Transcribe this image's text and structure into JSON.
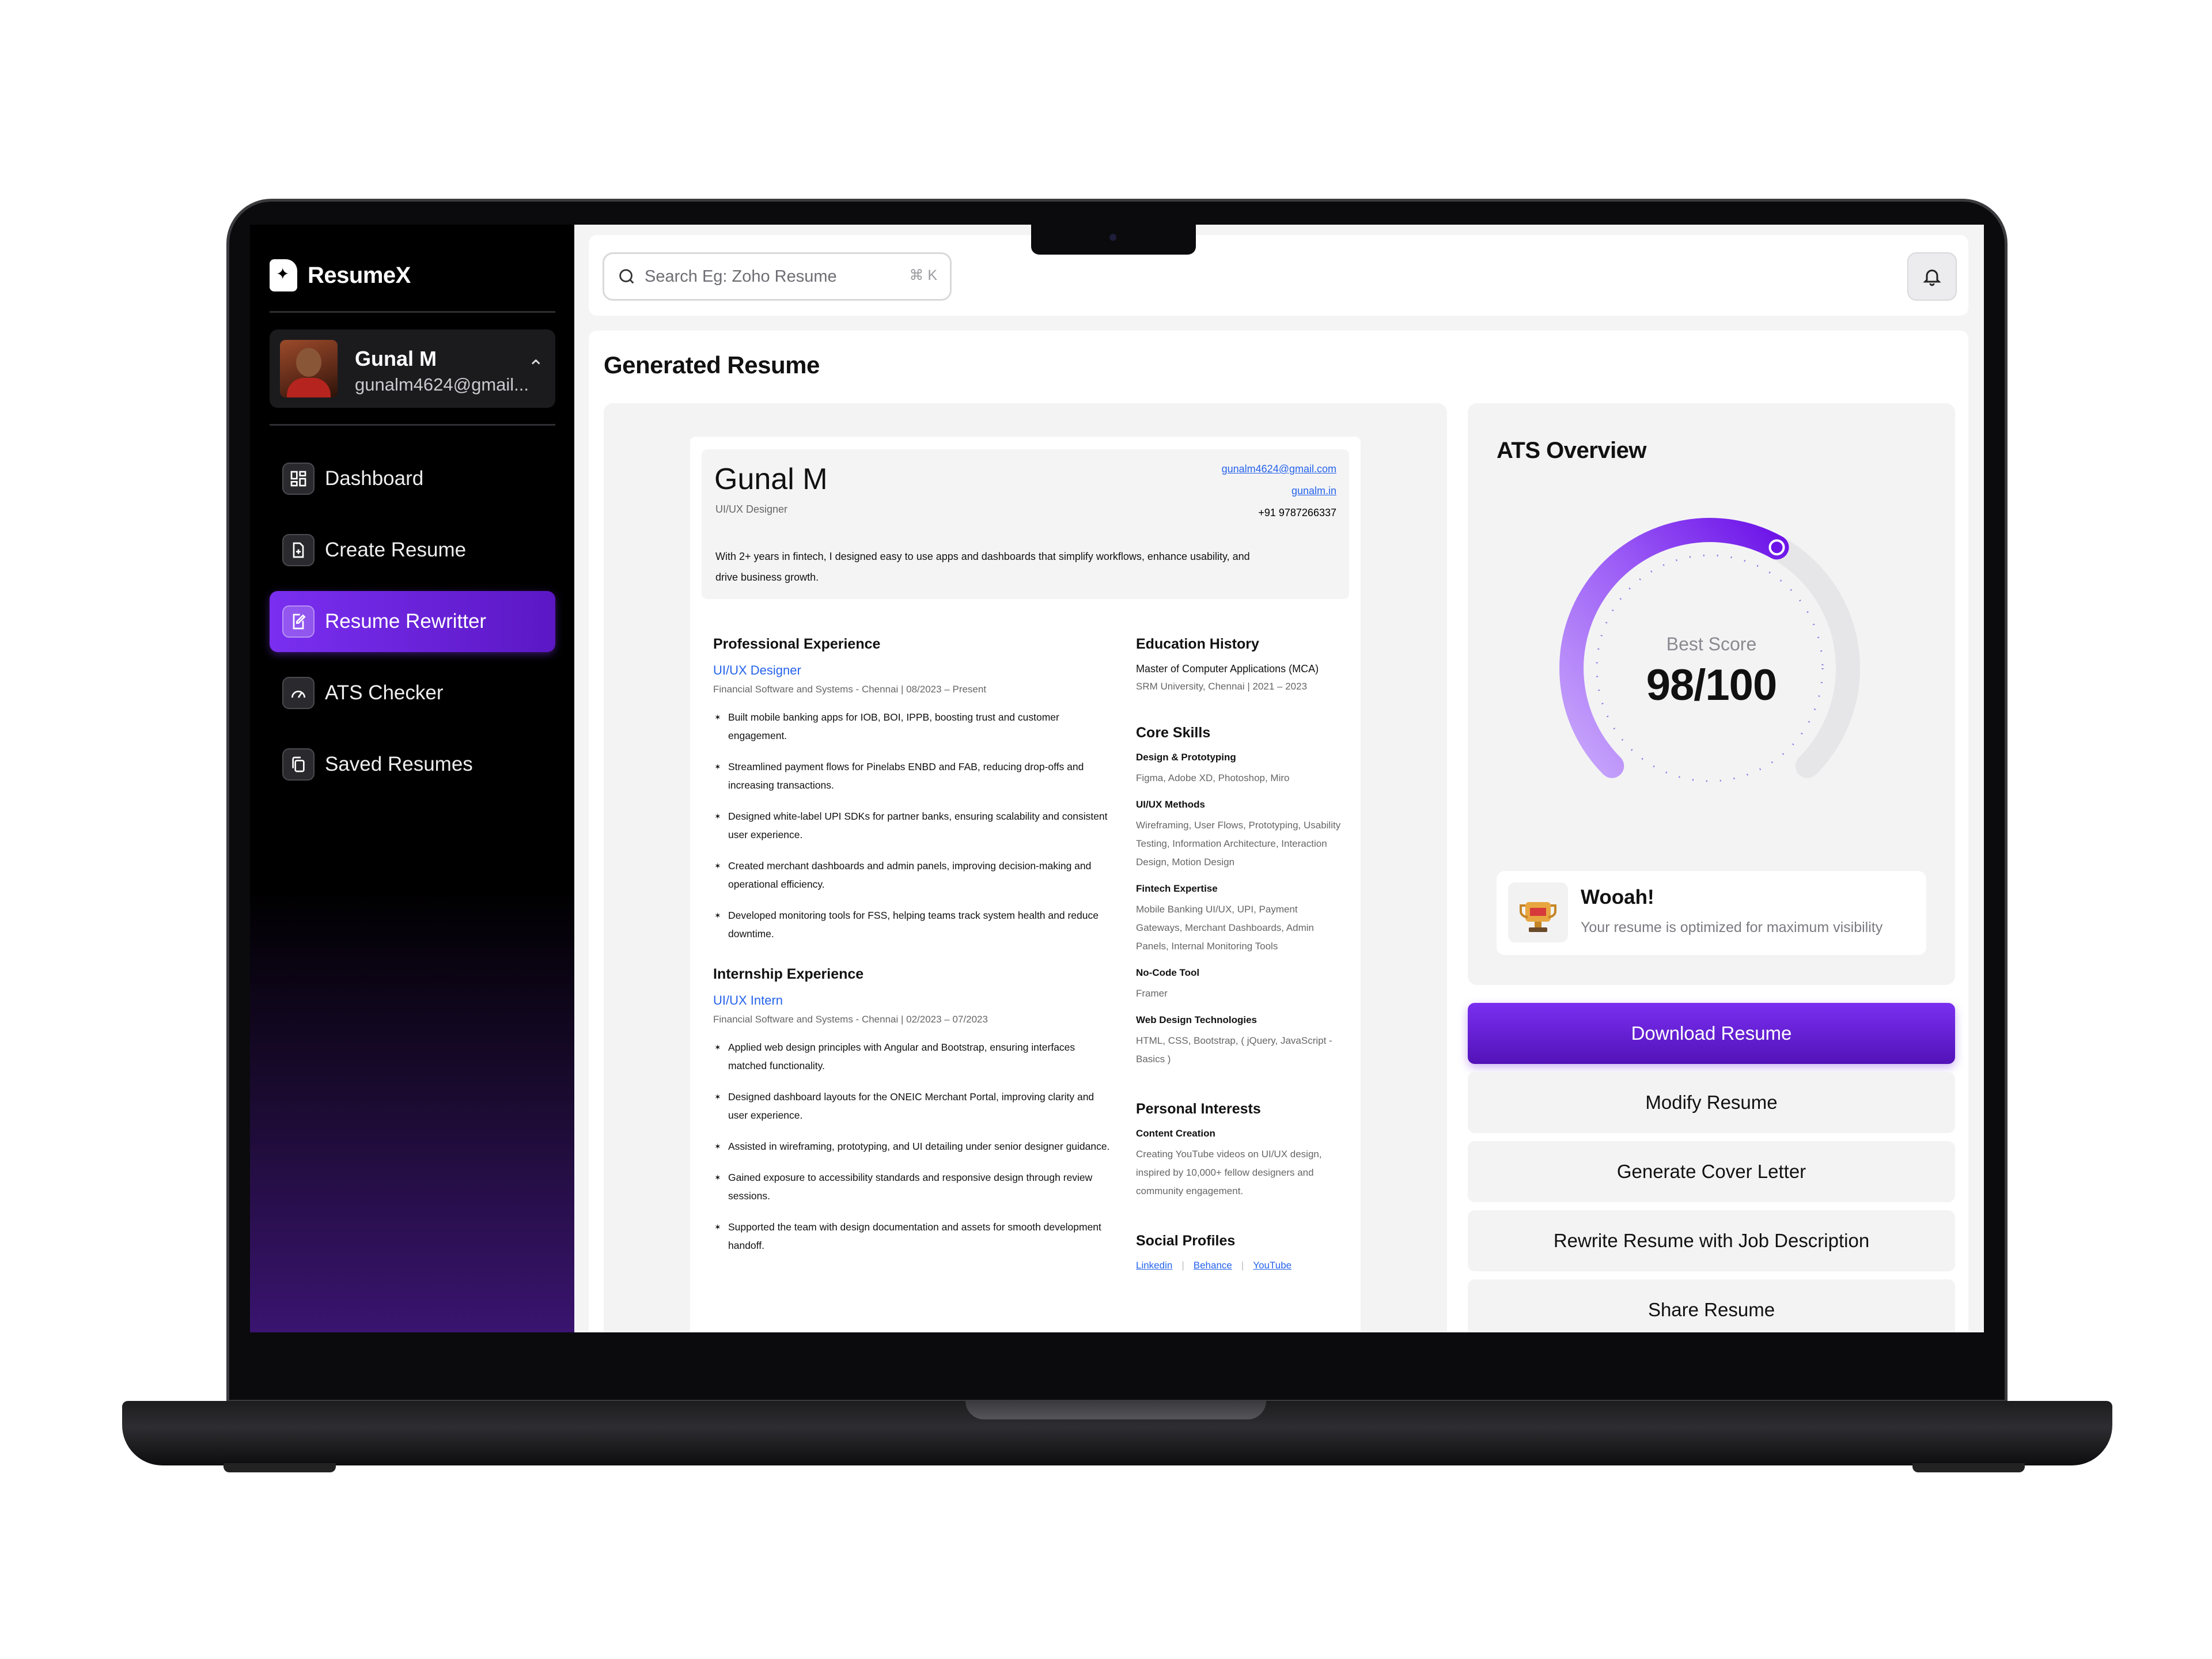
{
  "app": {
    "name": "ResumeX"
  },
  "profile": {
    "name": "Gunal M",
    "email": "gunalm4624@gmail..."
  },
  "nav": [
    {
      "label": "Dashboard",
      "active": false,
      "icon": "grid-icon"
    },
    {
      "label": "Create Resume",
      "active": false,
      "icon": "file-plus-icon"
    },
    {
      "label": "Resume Rewritter",
      "active": true,
      "icon": "edit-icon"
    },
    {
      "label": "ATS Checker",
      "active": false,
      "icon": "gauge-icon"
    },
    {
      "label": "Saved Resumes",
      "active": false,
      "icon": "copy-icon"
    }
  ],
  "search": {
    "placeholder": "Search Eg: Zoho Resume",
    "shortcut": "⌘ K"
  },
  "main": {
    "title": "Generated Resume"
  },
  "resume": {
    "name": "Gunal M",
    "title": "UI/UX Designer",
    "email": "gunalm4624@gmail.com",
    "website": "gunalm.in",
    "phone": "+91 9787266337",
    "summary": "With 2+ years in fintech, I designed easy to use apps and dashboards that simplify workflows, enhance usability, and drive business growth.",
    "experience": {
      "heading": "Professional Experience",
      "role": "UI/UX Designer",
      "meta": "Financial Software and Systems - Chennai   |   08/2023 – Present",
      "bullets": [
        "Built mobile banking apps for IOB, BOI, IPPB, boosting trust and customer engagement.",
        "Streamlined payment flows for Pinelabs ENBD and FAB, reducing drop-offs and increasing transactions.",
        "Designed white-label UPI SDKs for partner banks, ensuring scalability and consistent user experience.",
        "Created merchant dashboards and admin panels, improving decision-making and operational efficiency.",
        "Developed monitoring tools for FSS, helping teams track system health and reduce downtime."
      ]
    },
    "internship": {
      "heading": "Internship Experience",
      "role": "UI/UX Intern",
      "meta": "Financial Software and Systems - Chennai   |   02/2023 – 07/2023",
      "bullets": [
        "Applied web design principles with Angular and Bootstrap, ensuring interfaces matched functionality.",
        "Designed dashboard layouts for the ONEIC Merchant Portal, improving clarity and user experience.",
        "Assisted in wireframing, prototyping, and UI detailing under senior designer guidance.",
        "Gained exposure to accessibility standards and responsive design through review sessions.",
        "Supported the team with design documentation and assets for smooth development handoff."
      ]
    },
    "education": {
      "heading": "Education History",
      "degree": "Master of Computer Applications (MCA)",
      "meta": "SRM University, Chennai   |   2021 – 2023"
    },
    "skills": {
      "heading": "Core Skills",
      "groups": [
        {
          "title": "Design & Prototyping",
          "text": "Figma, Adobe XD, Photoshop, Miro"
        },
        {
          "title": "UI/UX Methods",
          "text": "Wireframing, User Flows, Prototyping, Usability Testing, Information Architecture, Interaction Design, Motion Design"
        },
        {
          "title": "Fintech Expertise",
          "text": "Mobile Banking UI/UX, UPI, Payment Gateways, Merchant Dashboards, Admin Panels, Internal Monitoring Tools"
        },
        {
          "title": "No-Code Tool",
          "text": "Framer"
        },
        {
          "title": "Web Design Technologies",
          "text": "HTML, CSS, Bootstrap, ( jQuery, JavaScript - Basics )"
        }
      ]
    },
    "interests": {
      "heading": "Personal Interests",
      "title": "Content Creation",
      "text": "Creating YouTube videos on UI/UX design, inspired by 10,000+ fellow designers and community engagement."
    },
    "socials": {
      "heading": "Social Profiles",
      "links": [
        "Linkedin",
        "Behance",
        "YouTube"
      ]
    }
  },
  "ats": {
    "title": "ATS Overview",
    "score_label": "Best Score",
    "score": "98/100",
    "score_fraction": 0.98,
    "toast_title": "Wooah!",
    "toast_msg": "Your resume is optimized for maximum visibility"
  },
  "actions": {
    "download": "Download Resume",
    "modify": "Modify Resume",
    "cover": "Generate Cover Letter",
    "rewrite": "Rewrite Resume with Job Description",
    "share": "Share Resume"
  },
  "colors": {
    "accent": "#7a2ff0",
    "accent_dark": "#5212b8",
    "link": "#2563eb"
  }
}
